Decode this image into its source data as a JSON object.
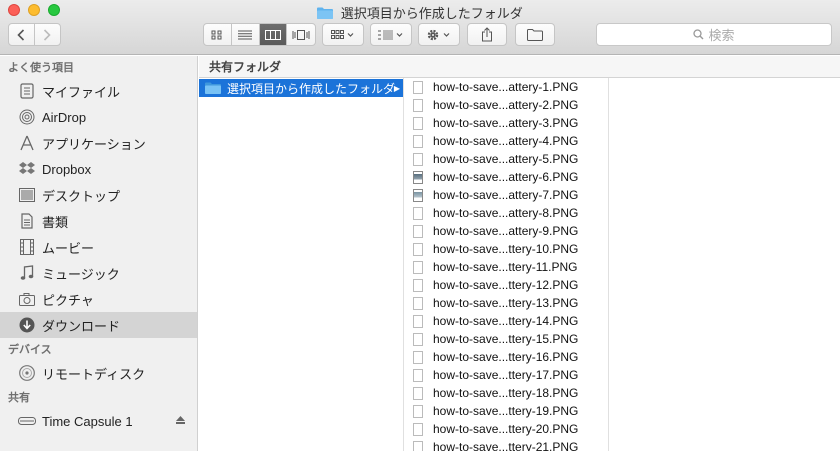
{
  "window": {
    "title": "選択項目から作成したフォルダ"
  },
  "toolbar": {
    "search_placeholder": "検索"
  },
  "sidebar": {
    "sections": [
      {
        "heading": "よく使う項目",
        "items": [
          {
            "label": "マイファイル",
            "icon": "all-files-icon"
          },
          {
            "label": "AirDrop",
            "icon": "airdrop-icon"
          },
          {
            "label": "アプリケーション",
            "icon": "applications-icon"
          },
          {
            "label": "Dropbox",
            "icon": "dropbox-icon"
          },
          {
            "label": "デスクトップ",
            "icon": "desktop-icon"
          },
          {
            "label": "書類",
            "icon": "documents-icon"
          },
          {
            "label": "ムービー",
            "icon": "movies-icon"
          },
          {
            "label": "ミュージック",
            "icon": "music-icon"
          },
          {
            "label": "ピクチャ",
            "icon": "pictures-icon"
          },
          {
            "label": "ダウンロード",
            "icon": "downloads-icon",
            "selected": true
          }
        ]
      },
      {
        "heading": "デバイス",
        "items": [
          {
            "label": "リモートディスク",
            "icon": "remote-disc-icon"
          }
        ]
      },
      {
        "heading": "共有",
        "items": [
          {
            "label": "Time Capsule 1",
            "icon": "time-capsule-icon",
            "eject": true
          }
        ]
      }
    ]
  },
  "pathbar": {
    "label": "共有フォルダ"
  },
  "column1": {
    "selected_folder": "選択項目から作成したフォルダ"
  },
  "column2": {
    "files": [
      {
        "name": "how-to-save...attery-1.PNG",
        "thumb": "doc"
      },
      {
        "name": "how-to-save...attery-2.PNG",
        "thumb": "doc"
      },
      {
        "name": "how-to-save...attery-3.PNG",
        "thumb": "doc"
      },
      {
        "name": "how-to-save...attery-4.PNG",
        "thumb": "doc"
      },
      {
        "name": "how-to-save...attery-5.PNG",
        "thumb": "doc"
      },
      {
        "name": "how-to-save...attery-6.PNG",
        "thumb": "img"
      },
      {
        "name": "how-to-save...attery-7.PNG",
        "thumb": "img2"
      },
      {
        "name": "how-to-save...attery-8.PNG",
        "thumb": "doc"
      },
      {
        "name": "how-to-save...attery-9.PNG",
        "thumb": "doc"
      },
      {
        "name": "how-to-save...ttery-10.PNG",
        "thumb": "doc"
      },
      {
        "name": "how-to-save...ttery-11.PNG",
        "thumb": "doc"
      },
      {
        "name": "how-to-save...ttery-12.PNG",
        "thumb": "doc"
      },
      {
        "name": "how-to-save...ttery-13.PNG",
        "thumb": "doc"
      },
      {
        "name": "how-to-save...ttery-14.PNG",
        "thumb": "doc"
      },
      {
        "name": "how-to-save...ttery-15.PNG",
        "thumb": "doc"
      },
      {
        "name": "how-to-save...ttery-16.PNG",
        "thumb": "doc"
      },
      {
        "name": "how-to-save...ttery-17.PNG",
        "thumb": "doc"
      },
      {
        "name": "how-to-save...ttery-18.PNG",
        "thumb": "doc"
      },
      {
        "name": "how-to-save...ttery-19.PNG",
        "thumb": "doc"
      },
      {
        "name": "how-to-save...ttery-20.PNG",
        "thumb": "doc"
      },
      {
        "name": "how-to-save...ttery-21.PNG",
        "thumb": "doc"
      }
    ]
  },
  "colors": {
    "selection": "#1b73d9",
    "folder": "#5fb3ee"
  }
}
